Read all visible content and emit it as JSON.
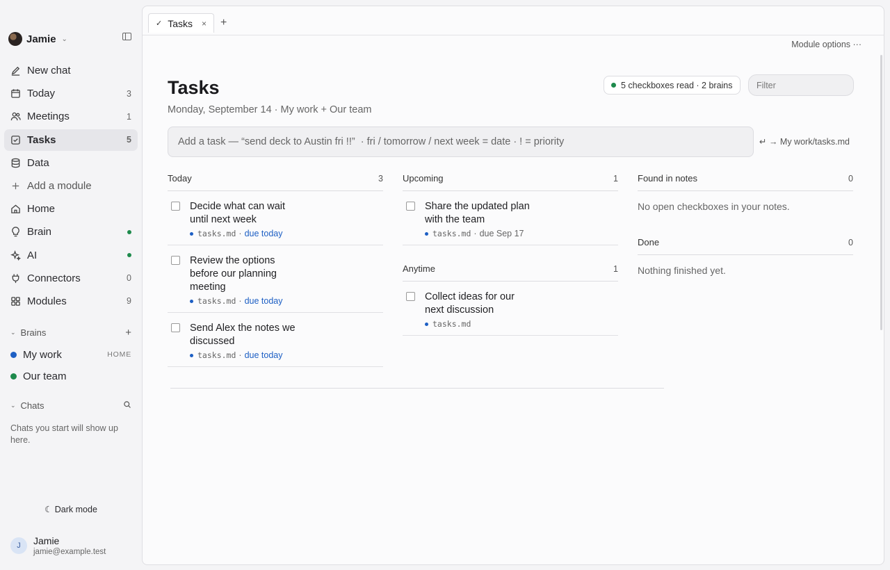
{
  "workspace": {
    "name": "Jamie"
  },
  "nav": [
    {
      "label": "New chat",
      "icon": "pencil-icon",
      "count": "",
      "active": false
    },
    {
      "label": "Today",
      "icon": "calendar-icon",
      "count": "3",
      "active": false
    },
    {
      "label": "Meetings",
      "icon": "people-icon",
      "count": "1",
      "active": false
    },
    {
      "label": "Tasks",
      "icon": "checkbox-icon",
      "count": "5",
      "active": true
    },
    {
      "label": "Data",
      "icon": "database-icon",
      "count": "",
      "active": false
    },
    {
      "label": "Add a module",
      "icon": "plus-icon",
      "count": "",
      "active": false
    },
    {
      "label": "Home",
      "icon": "home-icon",
      "count": "",
      "active": false
    },
    {
      "label": "Brain",
      "icon": "lightbulb-icon",
      "count": "",
      "dot": true
    },
    {
      "label": "AI",
      "icon": "sparkle-icon",
      "count": "",
      "dot": true
    },
    {
      "label": "Connectors",
      "icon": "plug-icon",
      "count": "0"
    },
    {
      "label": "Modules",
      "icon": "grid-icon",
      "count": "9"
    }
  ],
  "brains": {
    "title": "Brains",
    "items": [
      {
        "label": "My work",
        "tag": "HOME",
        "color": "#1d5fc4"
      },
      {
        "label": "Our team",
        "tag": "",
        "color": "#1e8a4c"
      }
    ]
  },
  "chats": {
    "title": "Chats",
    "empty": "Chats you start will show up here."
  },
  "dark_mode_label": "Dark mode",
  "user": {
    "initial": "J",
    "name": "Jamie",
    "email": "jamie@example.test"
  },
  "tabs": [
    {
      "label": "Tasks"
    }
  ],
  "module_options": "Module options ···",
  "page": {
    "title": "Tasks",
    "subtitle": "Monday, September 14 · My work + Our team",
    "status": "5 checkboxes read · 2 brains",
    "filter_placeholder": "Filter",
    "add_placeholder": "Add a task — “send deck to Austin fri !!”  · fri / tomorrow / next week = date · ! = priority",
    "target_hint": "↵ → My work/tasks.md"
  },
  "columns": {
    "today": {
      "title": "Today",
      "count": "3",
      "tasks": [
        {
          "title": "Decide what can wait until next week",
          "file": "tasks.md",
          "due": "due today"
        },
        {
          "title": "Review the options before our planning meeting",
          "file": "tasks.md",
          "due": "due today"
        },
        {
          "title": "Send Alex the notes we discussed",
          "file": "tasks.md",
          "due": "due today"
        }
      ]
    },
    "upcoming": {
      "title": "Upcoming",
      "count": "1",
      "tasks": [
        {
          "title": "Share the updated plan with the team",
          "file": "tasks.md",
          "due": "due Sep 17"
        }
      ]
    },
    "anytime": {
      "title": "Anytime",
      "count": "1",
      "tasks": [
        {
          "title": "Collect ideas for our next discussion",
          "file": "tasks.md",
          "due": ""
        }
      ]
    },
    "found": {
      "title": "Found in notes",
      "count": "0",
      "empty": "No open checkboxes in your notes."
    },
    "done": {
      "title": "Done",
      "count": "0",
      "empty": "Nothing finished yet."
    }
  }
}
